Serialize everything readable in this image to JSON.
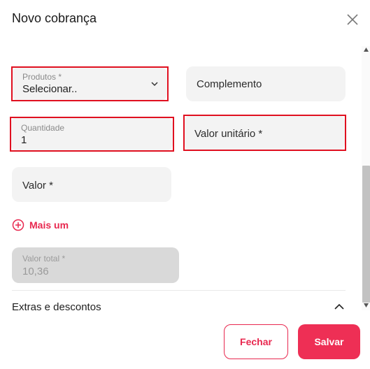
{
  "dialog": {
    "title": "Novo cobrança"
  },
  "form": {
    "produtos": {
      "label": "Produtos *",
      "value": "Selecionar.."
    },
    "complemento": {
      "placeholder": "Complemento"
    },
    "quantidade": {
      "label": "Quantidade",
      "value": "1"
    },
    "valor_unitario": {
      "placeholder": "Valor unitário *"
    },
    "valor": {
      "placeholder": "Valor *"
    },
    "add_more_label": "Mais um",
    "valor_total": {
      "label": "Valor total *",
      "value": "10,36"
    }
  },
  "sections": {
    "extras_label": "Extras e descontos"
  },
  "footer": {
    "fechar_label": "Fechar",
    "salvar_label": "Salvar"
  },
  "colors": {
    "accent": "#ee2f55",
    "highlight_border": "#e01020",
    "field_bg": "#f3f3f3",
    "disabled_bg": "#d9d9d9"
  },
  "icons": {
    "close": "close-icon",
    "dropdown": "chevron-down-icon",
    "add": "plus-circle-icon",
    "collapse": "chevron-up-icon"
  }
}
